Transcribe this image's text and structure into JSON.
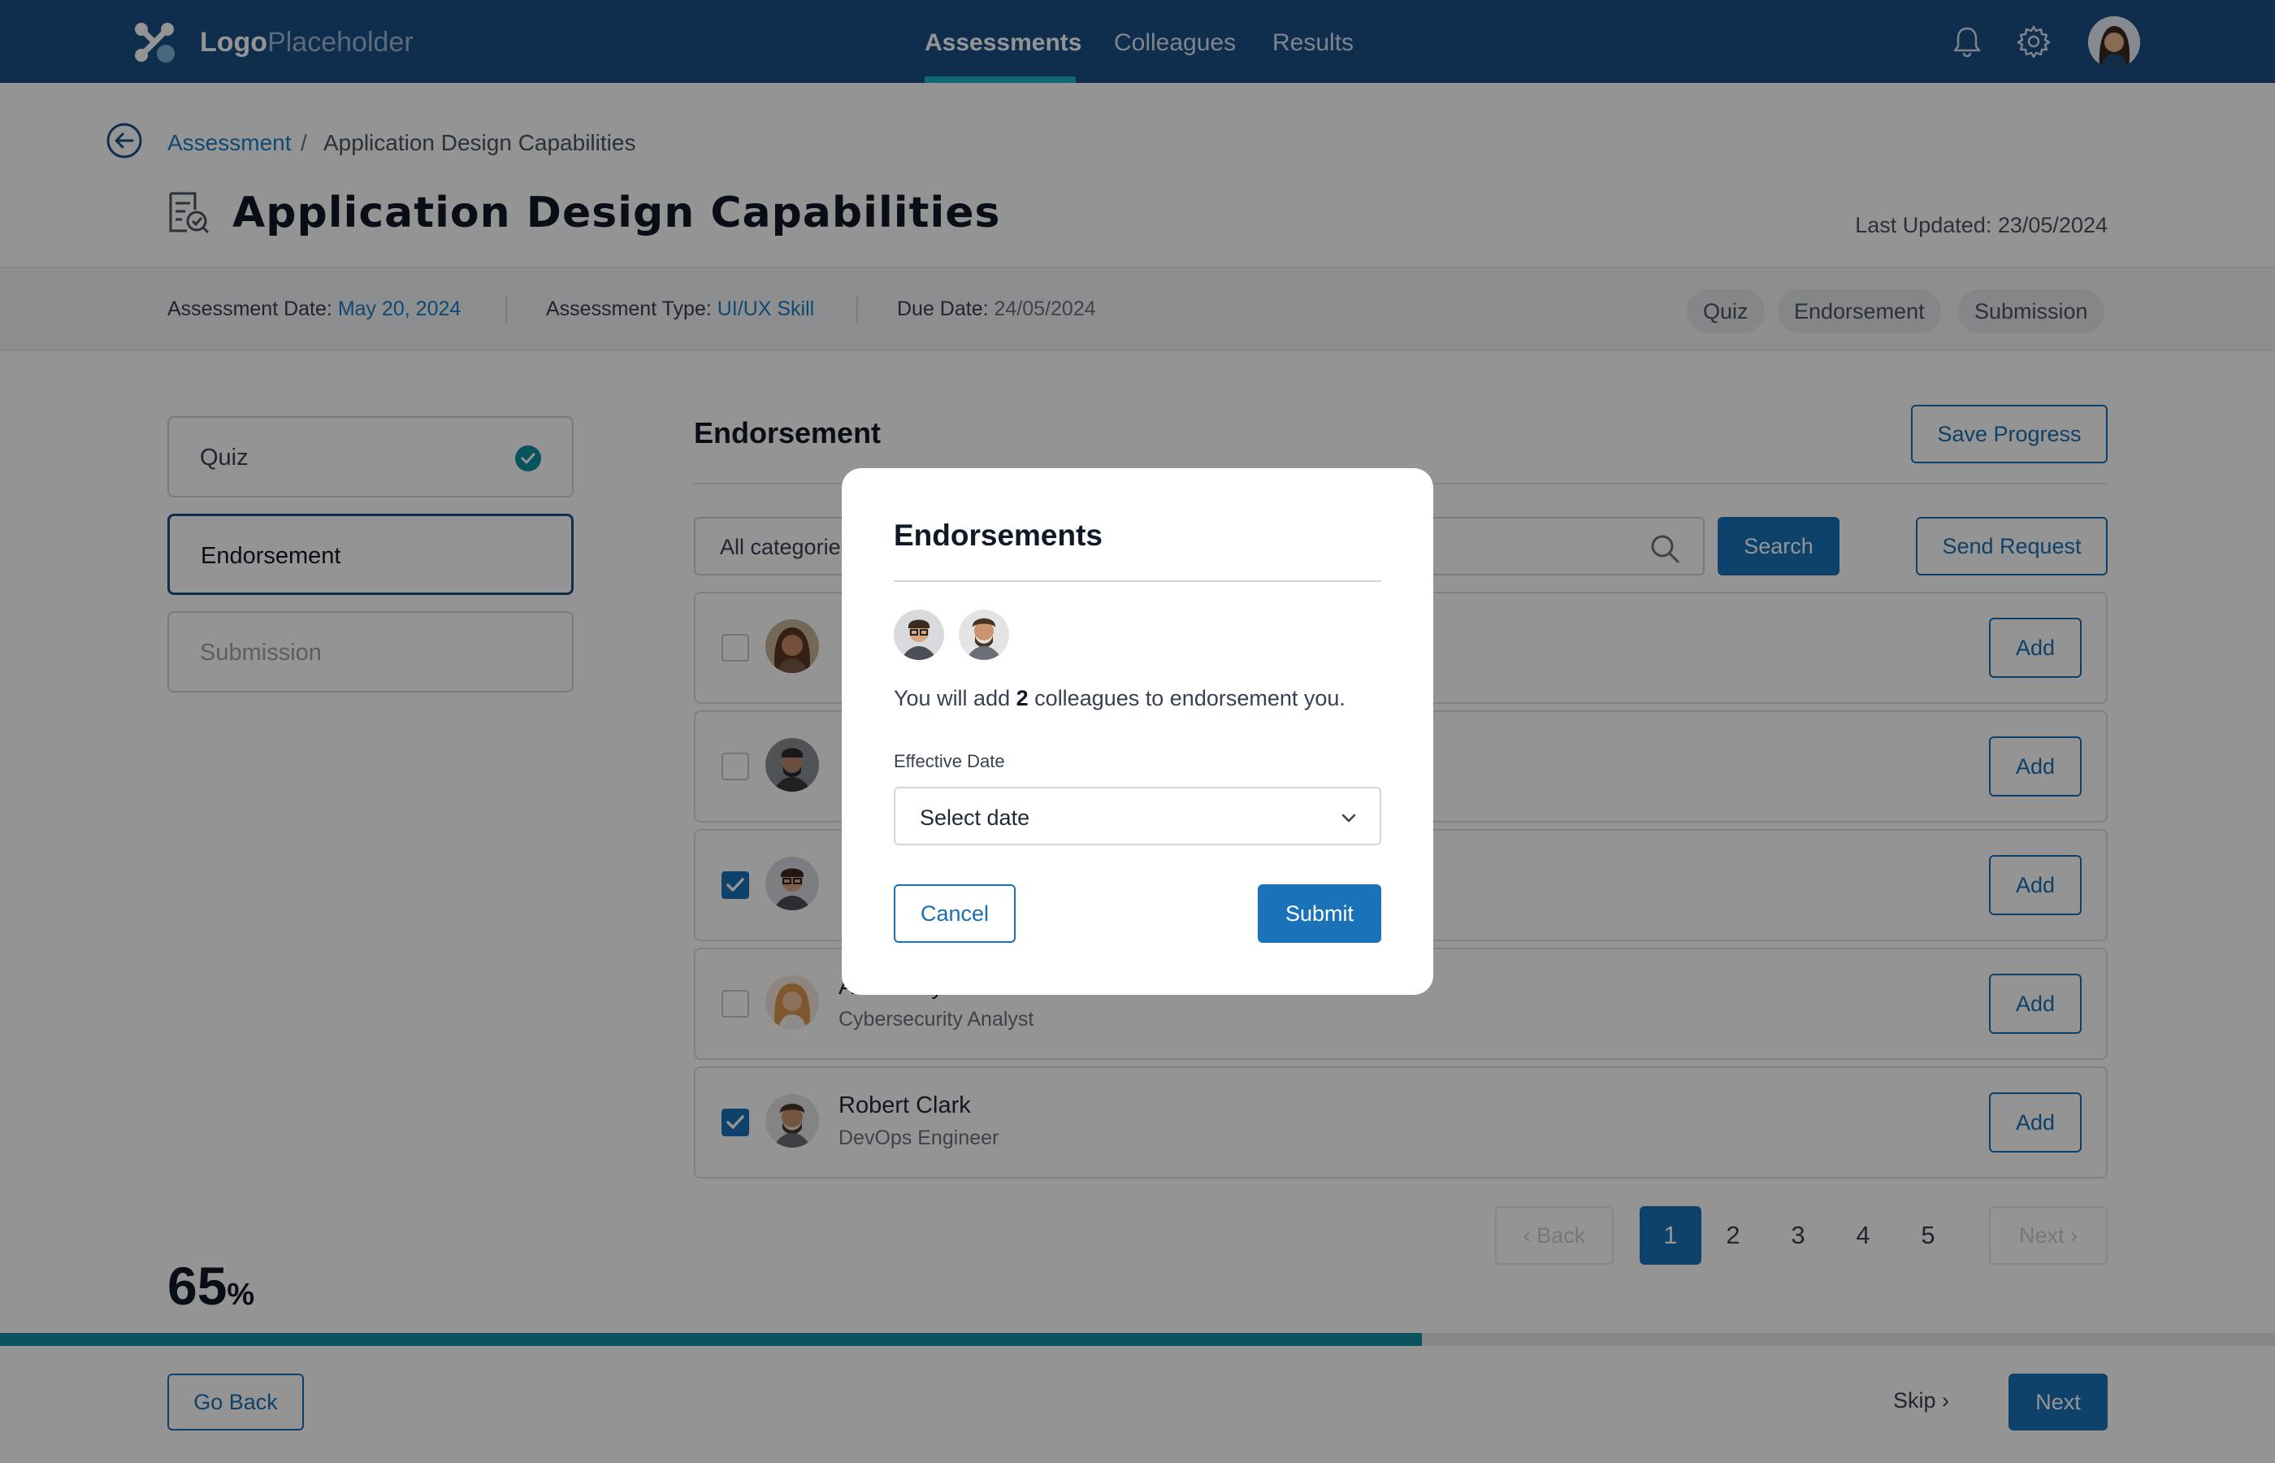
{
  "brand": {
    "logo_bold": "Logo",
    "logo_light": "Placeholder"
  },
  "nav": {
    "tabs": [
      {
        "label": "Assessments",
        "active": true
      },
      {
        "label": "Colleagues",
        "active": false
      },
      {
        "label": "Results",
        "active": false
      }
    ],
    "icons": [
      "bell-icon",
      "gear-icon"
    ]
  },
  "breadcrumb": {
    "parent": "Assessment",
    "separator": "/",
    "current": "Application Design Capabilities"
  },
  "header": {
    "title": "Application Design Capabilities",
    "last_updated_label": "Last Updated:",
    "last_updated_value": "23/05/2024"
  },
  "info": {
    "assessment_date_label": "Assessment Date:",
    "assessment_date_value": "May 20, 2024",
    "assessment_type_label": "Assessment Type:",
    "assessment_type_value": "UI/UX Skill",
    "due_date_label": "Due Date:",
    "due_date_value": "24/05/2024",
    "chips": [
      "Quiz",
      "Endorsement",
      "Submission"
    ]
  },
  "steps": [
    {
      "label": "Quiz",
      "state": "complete"
    },
    {
      "label": "Endorsement",
      "state": "active"
    },
    {
      "label": "Submission",
      "state": "disabled"
    }
  ],
  "main": {
    "section_title": "Endorsement",
    "save_label": "Save Progress",
    "search_placeholder": "All categories",
    "search_button": "Search",
    "send_request": "Send Request",
    "add_label": "Add",
    "colleagues": [
      {
        "name": "",
        "role": "",
        "checked": false
      },
      {
        "name": "",
        "role": "",
        "checked": false
      },
      {
        "name": "",
        "role": "",
        "checked": true
      },
      {
        "name": "Alicia Reye",
        "role": "Cybersecurity Analyst",
        "checked": false
      },
      {
        "name": "Robert Clark",
        "role": "DevOps Engineer",
        "checked": true
      }
    ]
  },
  "pagination": {
    "back": "Back",
    "next": "Next",
    "pages": [
      "1",
      "2",
      "3",
      "4",
      "5"
    ],
    "current": "1"
  },
  "progress": {
    "percent_value": "65",
    "percent_sign": "%",
    "fraction": 0.625
  },
  "footer": {
    "go_back": "Go Back",
    "skip": "Skip",
    "next": "Next"
  },
  "modal": {
    "title": "Endorsements",
    "msg_prefix": "You will add",
    "msg_count": "2",
    "msg_suffix": "colleagues to endorsement you.",
    "field_label": "Effective Date",
    "select_value": "Select date",
    "cancel": "Cancel",
    "submit": "Submit"
  },
  "colors": {
    "brand": "#1a4f86",
    "accent": "#1a73b8",
    "teal": "#0f8f9f",
    "link": "#1b7fc4"
  }
}
